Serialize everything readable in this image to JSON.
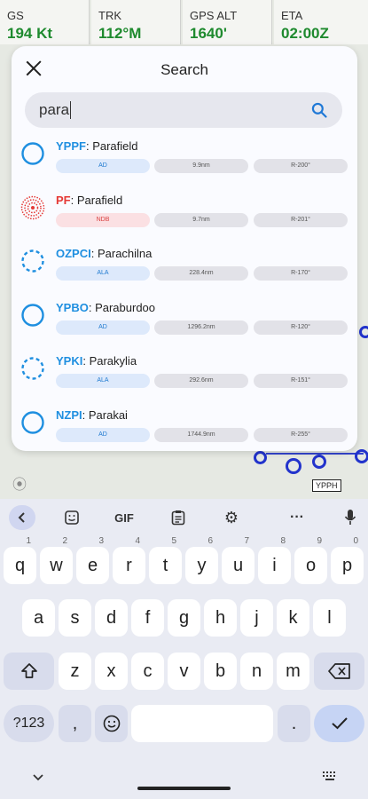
{
  "colors": {
    "accent_blue": "#1f8fe0",
    "ndb_red": "#e53935",
    "alt_green": "#1e8a2e"
  },
  "instruments": [
    {
      "label": "GS",
      "value": "194 Kt"
    },
    {
      "label": "TRK",
      "value": "112°M"
    },
    {
      "label": "GPS ALT",
      "value": "1640'"
    },
    {
      "label": "ETA",
      "value": "02:00Z"
    }
  ],
  "map": {
    "waypoint_label": "YPPH"
  },
  "dialog": {
    "close_icon": "close-icon",
    "title": "Search",
    "search": {
      "value": "para",
      "icon": "search-icon"
    }
  },
  "results": [
    {
      "code": "YPPF",
      "name": "Parafield",
      "type": "AD",
      "distance": "9.9nm",
      "radial": "R-200°",
      "icon": "circle-icon",
      "color": "blue"
    },
    {
      "code": "PF",
      "name": "Parafield",
      "type": "NDB",
      "distance": "9.7nm",
      "radial": "R-201°",
      "icon": "ndb-icon",
      "color": "red"
    },
    {
      "code": "OZPCI",
      "name": "Parachilna",
      "type": "ALA",
      "distance": "228.4nm",
      "radial": "R-170°",
      "icon": "dashed-circle-icon",
      "color": "blue"
    },
    {
      "code": "YPBO",
      "name": "Paraburdoo",
      "type": "AD",
      "distance": "1296.2nm",
      "radial": "R-120°",
      "icon": "circle-icon",
      "color": "blue"
    },
    {
      "code": "YPKI",
      "name": "Parakylia",
      "type": "ALA",
      "distance": "292.6nm",
      "radial": "R-151°",
      "icon": "dashed-circle-icon",
      "color": "blue"
    },
    {
      "code": "NZPI",
      "name": "Parakai",
      "type": "AD",
      "distance": "1744.9nm",
      "radial": "R-255°",
      "icon": "circle-icon",
      "color": "blue"
    }
  ],
  "keyboard": {
    "toolbar": {
      "back": "back-chevron-icon",
      "sticker": "sticker-icon",
      "gif": "GIF",
      "clipboard": "clipboard-icon",
      "settings": "gear-icon",
      "more": "more-dots-icon",
      "mic": "mic-icon"
    },
    "row1": [
      {
        "key": "q",
        "hint": "1"
      },
      {
        "key": "w",
        "hint": "2"
      },
      {
        "key": "e",
        "hint": "3"
      },
      {
        "key": "r",
        "hint": "4"
      },
      {
        "key": "t",
        "hint": "5"
      },
      {
        "key": "y",
        "hint": "6"
      },
      {
        "key": "u",
        "hint": "7"
      },
      {
        "key": "i",
        "hint": "8"
      },
      {
        "key": "o",
        "hint": "9"
      },
      {
        "key": "p",
        "hint": "0"
      }
    ],
    "row2": [
      "a",
      "s",
      "d",
      "f",
      "g",
      "h",
      "j",
      "k",
      "l"
    ],
    "row3": [
      "z",
      "x",
      "c",
      "v",
      "b",
      "n",
      "m"
    ],
    "shift": "shift-icon",
    "backspace": "backspace-icon",
    "symbols": "?123",
    "comma": ",",
    "emoji": "emoji-icon",
    "period": ".",
    "enter": "check-icon",
    "nav_collapse": "chevron-down-icon",
    "nav_keyboard": "keyboard-grid-icon"
  }
}
